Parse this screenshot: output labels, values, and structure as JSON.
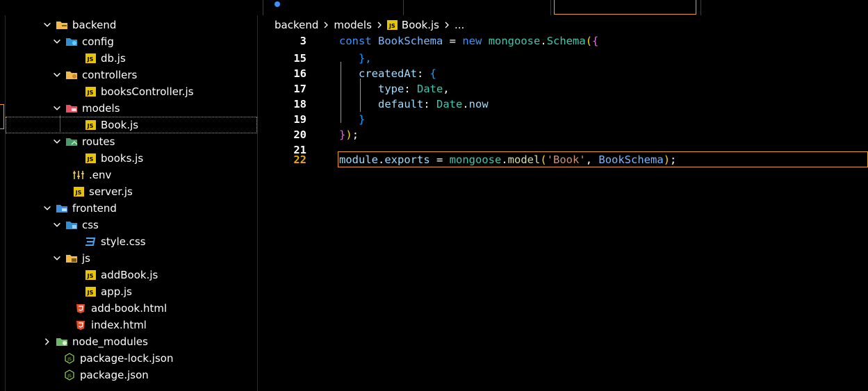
{
  "explorer": {
    "items": [
      {
        "label": "backend",
        "kind": "folder",
        "icon": "folder-backend-icon",
        "expanded": true,
        "depth": 0
      },
      {
        "label": "config",
        "kind": "folder",
        "icon": "folder-config-icon",
        "expanded": true,
        "depth": 1
      },
      {
        "label": "db.js",
        "kind": "file",
        "icon": "js-file-icon",
        "depth": 2
      },
      {
        "label": "controllers",
        "kind": "folder",
        "icon": "folder-controllers-icon",
        "expanded": true,
        "depth": 1
      },
      {
        "label": "booksController.js",
        "kind": "file",
        "icon": "js-file-icon",
        "depth": 2
      },
      {
        "label": "models",
        "kind": "folder",
        "icon": "folder-models-icon",
        "expanded": true,
        "depth": 1
      },
      {
        "label": "Book.js",
        "kind": "file",
        "icon": "js-file-icon",
        "depth": 2,
        "selected": true
      },
      {
        "label": "routes",
        "kind": "folder",
        "icon": "folder-routes-icon",
        "expanded": true,
        "depth": 1
      },
      {
        "label": "books.js",
        "kind": "file",
        "icon": "js-file-icon",
        "depth": 2
      },
      {
        "label": ".env",
        "kind": "file",
        "icon": "env-file-icon",
        "depth": 1
      },
      {
        "label": "server.js",
        "kind": "file",
        "icon": "js-file-icon",
        "depth": 1
      },
      {
        "label": "frontend",
        "kind": "folder",
        "icon": "folder-frontend-icon",
        "expanded": true,
        "depth": 0
      },
      {
        "label": "css",
        "kind": "folder",
        "icon": "folder-css-icon",
        "expanded": true,
        "depth": 1
      },
      {
        "label": "style.css",
        "kind": "file",
        "icon": "css-file-icon",
        "depth": 2
      },
      {
        "label": "js",
        "kind": "folder",
        "icon": "folder-js-icon",
        "expanded": true,
        "depth": 1
      },
      {
        "label": "addBook.js",
        "kind": "file",
        "icon": "js-file-icon",
        "depth": 2
      },
      {
        "label": "app.js",
        "kind": "file",
        "icon": "js-file-icon",
        "depth": 2
      },
      {
        "label": "add-book.html",
        "kind": "file",
        "icon": "html-file-icon",
        "depth": 1
      },
      {
        "label": "index.html",
        "kind": "file",
        "icon": "html-file-icon",
        "depth": 1
      },
      {
        "label": "node_modules",
        "kind": "folder",
        "icon": "folder-node-icon",
        "expanded": false,
        "depth": 0
      },
      {
        "label": "package-lock.json",
        "kind": "file",
        "icon": "nodejs-file-icon",
        "depth": 0
      },
      {
        "label": "package.json",
        "kind": "file",
        "icon": "nodejs-file-icon",
        "depth": 0
      }
    ]
  },
  "breadcrumb": {
    "parts": [
      "backend",
      "models",
      "Book.js",
      "..."
    ]
  },
  "editor": {
    "lines": [
      {
        "number": "3",
        "active": false
      },
      {
        "number": "15",
        "active": false
      },
      {
        "number": "16",
        "active": false
      },
      {
        "number": "17",
        "active": false
      },
      {
        "number": "18",
        "active": false
      },
      {
        "number": "19",
        "active": false
      },
      {
        "number": "20",
        "active": false
      },
      {
        "number": "21",
        "active": false
      },
      {
        "number": "22",
        "active": true
      }
    ],
    "tokens": {
      "l3": [
        "const",
        " ",
        "BookSchema",
        " = ",
        "new",
        " ",
        "mongoose",
        ".",
        "Schema",
        "(",
        "{"
      ],
      "l15": [
        "},"
      ],
      "l16": [
        "createdAt",
        ": ",
        "{"
      ],
      "l17": [
        "type",
        ": ",
        "Date",
        ","
      ],
      "l18": [
        "default",
        ": ",
        "Date",
        ".",
        "now"
      ],
      "l19": [
        "}"
      ],
      "l20": [
        "}",
        ")",
        ";"
      ],
      "l22": [
        "module",
        ".",
        "exports",
        " = ",
        "mongoose",
        ".",
        "model",
        "(",
        "'Book'",
        ", ",
        "BookSchema",
        ")",
        ";"
      ]
    }
  },
  "colors": {
    "accent": "#f0a30a",
    "background": "#000000",
    "keyword": "#3794ff",
    "js_badge": "#e8c500"
  }
}
